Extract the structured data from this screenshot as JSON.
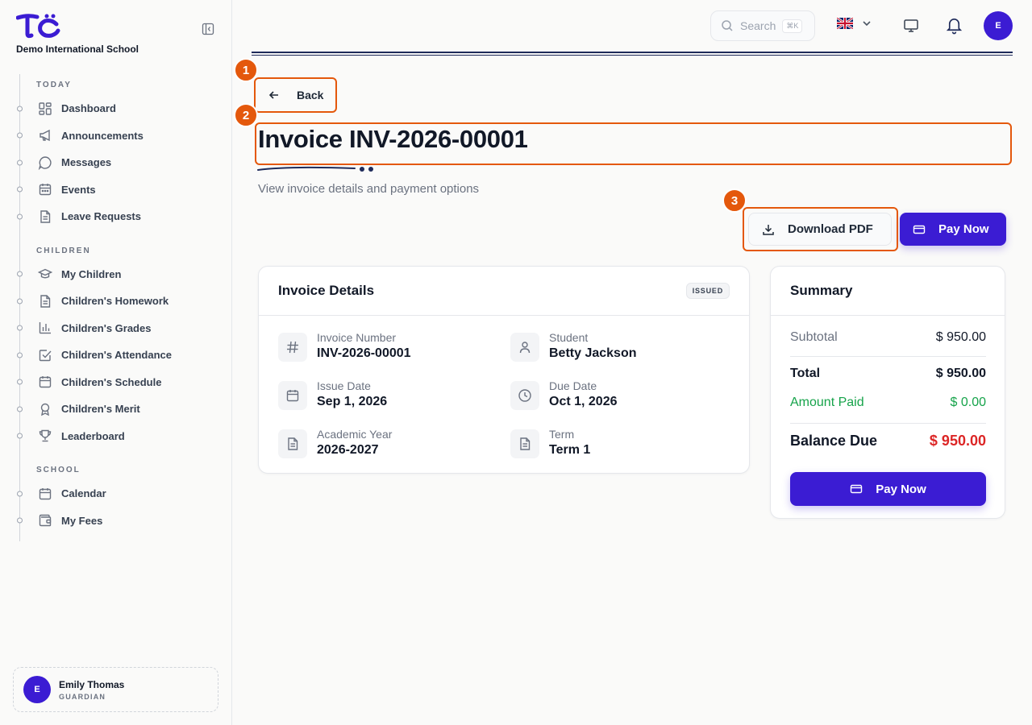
{
  "sidebar": {
    "school_name": "Demo International School",
    "sections": [
      {
        "label": "TODAY",
        "items": [
          {
            "label": "Dashboard",
            "icon": "dashboard-icon"
          },
          {
            "label": "Announcements",
            "icon": "megaphone-icon"
          },
          {
            "label": "Messages",
            "icon": "message-icon"
          },
          {
            "label": "Events",
            "icon": "calendar-icon"
          },
          {
            "label": "Leave Requests",
            "icon": "document-icon"
          }
        ]
      },
      {
        "label": "CHILDREN",
        "items": [
          {
            "label": "My Children",
            "icon": "graduation-cap-icon"
          },
          {
            "label": "Children's Homework",
            "icon": "document-icon"
          },
          {
            "label": "Children's Grades",
            "icon": "bar-chart-icon"
          },
          {
            "label": "Children's Attendance",
            "icon": "checkbox-icon"
          },
          {
            "label": "Children's Schedule",
            "icon": "calendar-icon"
          },
          {
            "label": "Children's Merit",
            "icon": "award-icon"
          },
          {
            "label": "Leaderboard",
            "icon": "trophy-icon"
          }
        ]
      },
      {
        "label": "SCHOOL",
        "items": [
          {
            "label": "Calendar",
            "icon": "calendar-icon"
          },
          {
            "label": "My Fees",
            "icon": "wallet-icon"
          }
        ]
      }
    ],
    "user": {
      "initial": "E",
      "name": "Emily Thomas",
      "role": "GUARDIAN"
    }
  },
  "topbar": {
    "search_placeholder": "Search",
    "search_shortcut": "⌘K",
    "avatar_initial": "E"
  },
  "annotations": [
    "1",
    "2",
    "3"
  ],
  "page": {
    "back_label": "Back",
    "title": "Invoice INV-2026-00001",
    "subtitle": "View invoice details and payment options",
    "download_label": "Download PDF",
    "pay_label": "Pay Now"
  },
  "details": {
    "title": "Invoice Details",
    "status": "ISSUED",
    "fields": [
      {
        "label": "Invoice Number",
        "value": "INV-2026-00001",
        "icon": "hash-icon"
      },
      {
        "label": "Student",
        "value": "Betty Jackson",
        "icon": "user-icon"
      },
      {
        "label": "Issue Date",
        "value": "Sep 1, 2026",
        "icon": "calendar-icon"
      },
      {
        "label": "Due Date",
        "value": "Oct 1, 2026",
        "icon": "clock-icon"
      },
      {
        "label": "Academic Year",
        "value": "2026-2027",
        "icon": "document-icon"
      },
      {
        "label": "Term",
        "value": "Term 1",
        "icon": "document-icon"
      }
    ]
  },
  "summary": {
    "title": "Summary",
    "subtotal_label": "Subtotal",
    "subtotal": "$ 950.00",
    "total_label": "Total",
    "total": "$ 950.00",
    "paid_label": "Amount Paid",
    "paid": "$ 0.00",
    "balance_label": "Balance Due",
    "balance": "$ 950.00",
    "pay_label": "Pay Now"
  },
  "colors": {
    "primary": "#3b1cd3",
    "annotation": "#e4580c",
    "paid": "#16a34a",
    "balance": "#dc2626"
  }
}
